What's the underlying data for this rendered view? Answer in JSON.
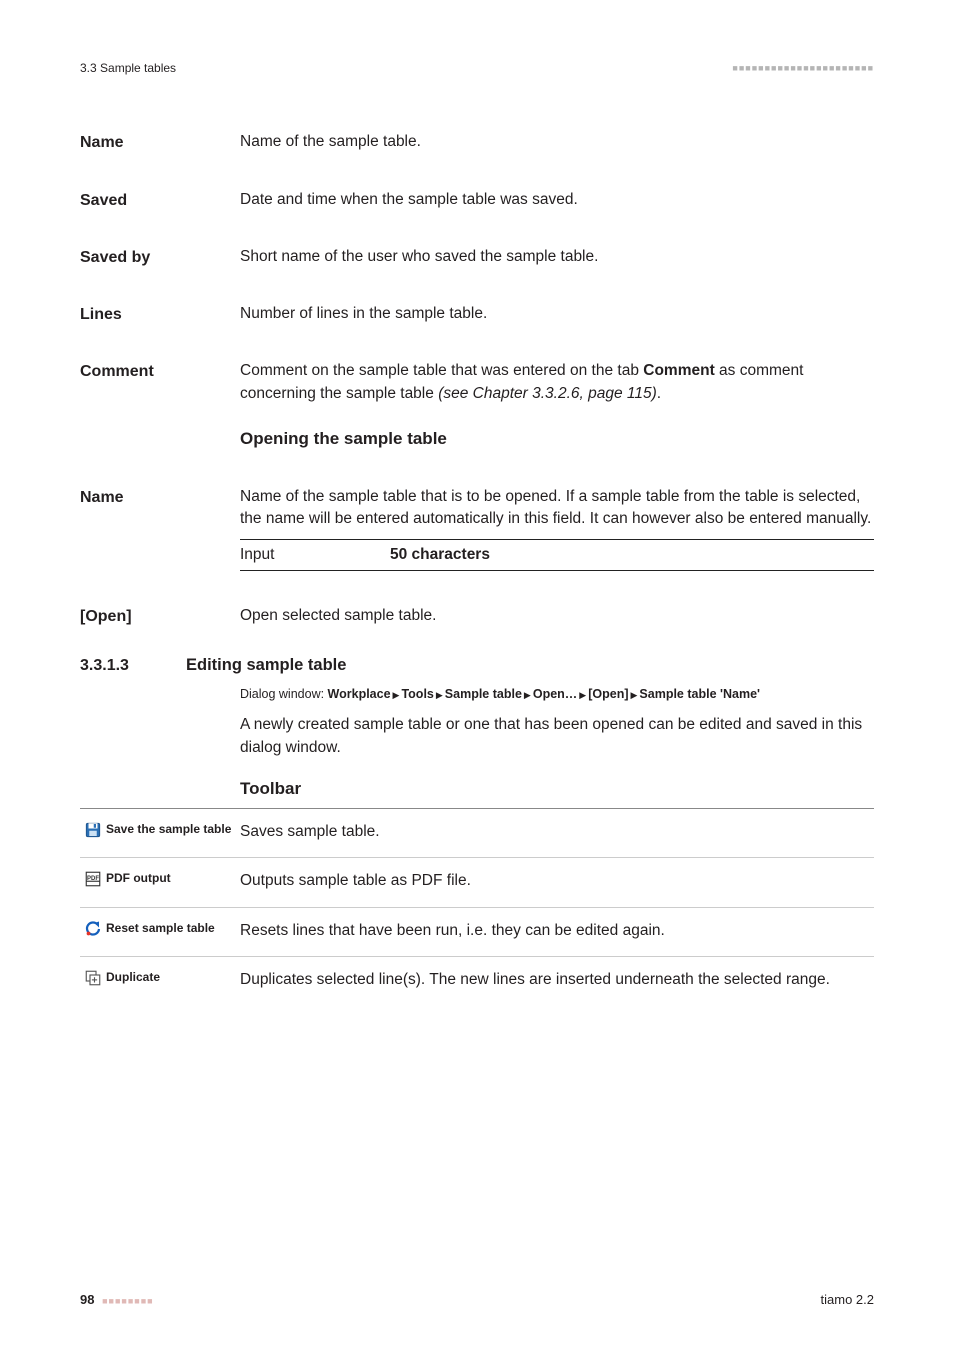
{
  "header": {
    "section_ref": "3.3 Sample tables",
    "squares": "■■■■■■■■■■■■■■■■■■■■■■"
  },
  "defs": {
    "name1_label": "Name",
    "name1_body": "Name of the sample table.",
    "saved_label": "Saved",
    "saved_body": "Date and time when the sample table was saved.",
    "savedby_label": "Saved by",
    "savedby_body": "Short name of the user who saved the sample table.",
    "lines_label": "Lines",
    "lines_body": "Number of lines in the sample table.",
    "comment_label": "Comment",
    "comment_body_a": "Comment on the sample table that was entered on the tab ",
    "comment_body_bold": "Comment",
    "comment_body_b": " as comment concerning the sample table ",
    "comment_body_italic": "(see Chapter 3.3.2.6, page 115)",
    "comment_body_c": "."
  },
  "opening": {
    "heading": "Opening the sample table",
    "name_label": "Name",
    "name_body": "Name of the sample table that is to be opened. If a sample table from the table is selected, the name will be entered automatically in this field. It can however also be entered manually.",
    "input_label": "Input",
    "input_value": "50 characters",
    "open_label": "[Open]",
    "open_body": "Open selected sample table."
  },
  "section": {
    "number": "3.3.1.3",
    "title": "Editing sample table",
    "dialog_prefix": "Dialog window: ",
    "dialog_parts": [
      "Workplace",
      "Tools",
      "Sample table",
      "Open…",
      "[Open]",
      "Sample table 'Name'"
    ],
    "para": "A newly created sample table or one that has been opened can be edited and saved in this dialog window.",
    "toolbar_heading": "Toolbar"
  },
  "toolbar": [
    {
      "icon": "save-icon",
      "label": "Save the sample table",
      "body": "Saves sample table."
    },
    {
      "icon": "pdf-icon",
      "label": "PDF output",
      "body": "Outputs sample table as PDF file."
    },
    {
      "icon": "reset-icon",
      "label": "Reset sample table",
      "body": "Resets lines that have been run, i.e. they can be edited again."
    },
    {
      "icon": "duplicate-icon",
      "label": "Duplicate",
      "body": "Duplicates selected line(s). The new lines are inserted underneath the selected range."
    }
  ],
  "footer": {
    "page": "98",
    "squares": "■■■■■■■■",
    "product": "tiamo 2.2"
  }
}
